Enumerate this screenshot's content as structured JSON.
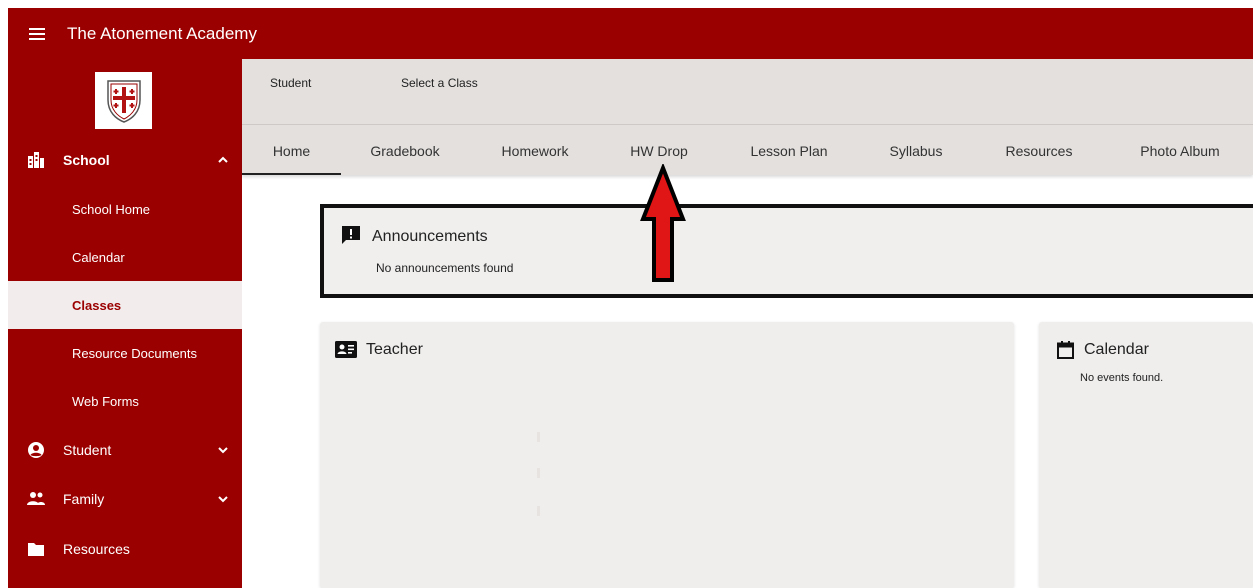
{
  "app": {
    "title": "The Atonement Academy"
  },
  "sidebar": {
    "school": {
      "label": "School"
    },
    "items": [
      {
        "label": "School Home"
      },
      {
        "label": "Calendar"
      },
      {
        "label": "Classes"
      },
      {
        "label": "Resource Documents"
      },
      {
        "label": "Web Forms"
      }
    ],
    "student": {
      "label": "Student"
    },
    "family": {
      "label": "Family"
    },
    "resources": {
      "label": "Resources"
    }
  },
  "classbar": {
    "student_label": "Student",
    "class_label": "Select a Class"
  },
  "tabs": [
    {
      "label": "Home"
    },
    {
      "label": "Gradebook"
    },
    {
      "label": "Homework"
    },
    {
      "label": "HW Drop"
    },
    {
      "label": "Lesson Plan"
    },
    {
      "label": "Syllabus"
    },
    {
      "label": "Resources"
    },
    {
      "label": "Photo Album"
    }
  ],
  "announcements": {
    "title": "Announcements",
    "empty_text": "No announcements found"
  },
  "teacher": {
    "title": "Teacher"
  },
  "calendar": {
    "title": "Calendar",
    "empty_text": "No events found."
  },
  "colors": {
    "brand": "#9b0000",
    "arrow": "#e01515"
  },
  "icons": {
    "menu": "hamburger-icon",
    "school": "building-icon",
    "student": "account-circle-icon",
    "family": "people-icon",
    "resources": "folder-icon",
    "announcements": "alert-message-icon",
    "teacher": "id-card-icon",
    "calendar": "calendar-icon"
  }
}
